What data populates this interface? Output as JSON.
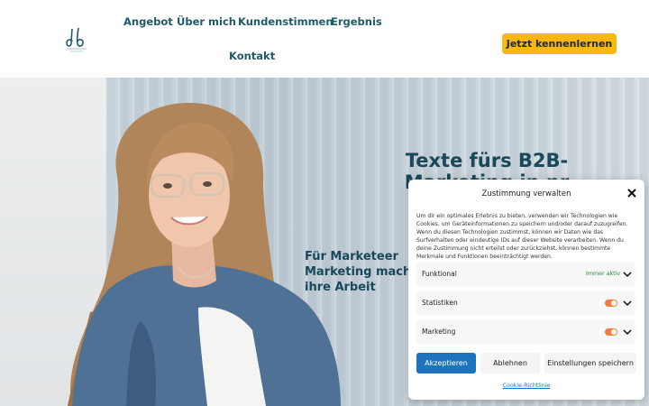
{
  "nav": {
    "items": [
      {
        "label": "Angebot"
      },
      {
        "label": "Über mich"
      },
      {
        "label": "Kundenstimmen"
      },
      {
        "label": "Ergebnis"
      },
      {
        "label": "Kontakt"
      }
    ],
    "cta_label": "Jetzt kennenlernen"
  },
  "hero": {
    "title": "Texte fürs B2B-Marketing in pr",
    "subtitle": "Für Marketeer Marketing mach und ihre Arbeit"
  },
  "consent": {
    "title": "Zustimmung verwalten",
    "text": "Um dir ein optimales Erlebnis zu bieten, verwenden wir Technologien wie Cookies, um Geräteinformationen zu speichern und/oder darauf zuzugreifen. Wenn du diesen Technologien zustimmst, können wir Daten wie das Surfverhalten oder eindeutige IDs auf dieser Website verarbeiten. Wenn du deine Zustimmung nicht erteilst oder zurückziehst, können bestimmte Merkmale und Funktionen beeinträchtigt werden.",
    "categories": [
      {
        "label": "Funktional",
        "status": "Immer aktiv"
      },
      {
        "label": "Statistiken"
      },
      {
        "label": "Marketing"
      }
    ],
    "accept_label": "Akzeptieren",
    "deny_label": "Ablehnen",
    "settings_label": "Einstellungen speichern",
    "policy_link": "Cookie-Richtlinie"
  },
  "colors": {
    "brand": "#1d5b6b",
    "cta": "#f8b711",
    "accept": "#1e73be",
    "toggle": "#f57d3c",
    "status_active": "#1e8f3e"
  },
  "icons": [
    "logo-db",
    "close-icon",
    "chevron-down-icon"
  ]
}
